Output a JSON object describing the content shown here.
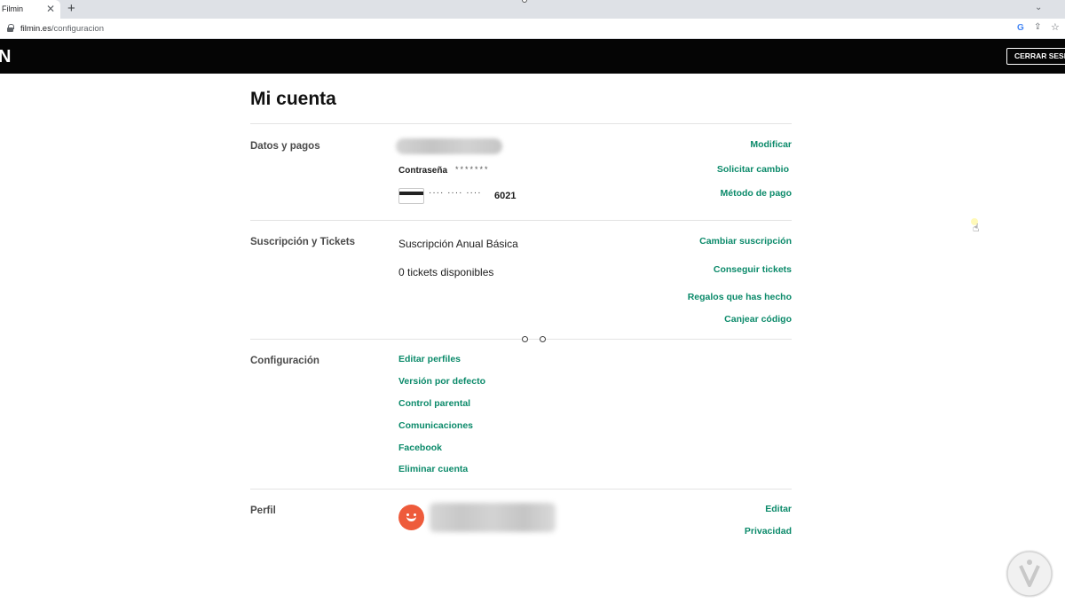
{
  "browser": {
    "tab_title": "Filmin",
    "tab_close": "✕",
    "new_tab": "+",
    "url_domain": "filmin.es",
    "url_path": "/configuracion",
    "tab_menu_icon": "chevron-down-icon",
    "google_icon_glyph": "G",
    "share_icon_glyph": "⇪",
    "bookmark_icon_glyph": "☆"
  },
  "site": {
    "logo": "N",
    "logout_label": "CERRAR SESIÓN"
  },
  "page": {
    "title": "Mi cuenta"
  },
  "datos_pagos": {
    "label": "Datos y pagos",
    "password_label": "Contraseña",
    "password_mask": "*******",
    "card_dots": "···· ···· ····",
    "card_last4": "6021",
    "modify_link": "Modificar",
    "change_request_link": "Solicitar cambio",
    "payment_method_link": "Método de pago"
  },
  "suscripcion": {
    "label": "Suscripción y Tickets",
    "plan": "Suscripción Anual Básica",
    "tickets": "0 tickets disponibles",
    "change_sub_link": "Cambiar suscripción",
    "get_tickets_link": "Conseguir tickets",
    "gifts_link": "Regalos que has hecho",
    "redeem_link": "Canjear código"
  },
  "configuracion": {
    "label": "Configuración",
    "items": [
      "Editar perfiles",
      "Versión por defecto",
      "Control parental",
      "Comunicaciones",
      "Facebook",
      "Eliminar cuenta"
    ]
  },
  "perfil": {
    "label": "Perfil",
    "edit_link": "Editar",
    "privacy_link": "Privacidad"
  },
  "colors": {
    "link_green": "#0b8a6a",
    "header_black": "#050505",
    "avatar_orange": "#ee5b3b"
  }
}
